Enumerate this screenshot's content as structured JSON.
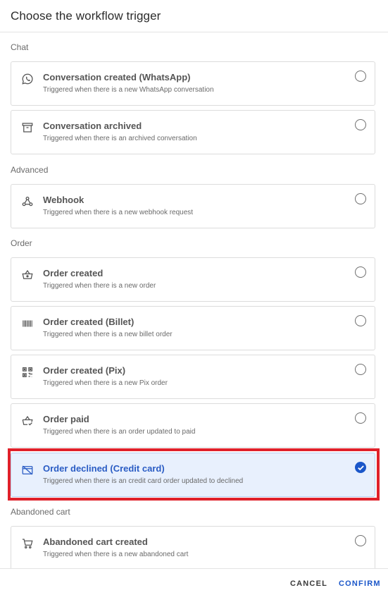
{
  "dialog": {
    "title": "Choose the workflow trigger"
  },
  "sections": {
    "chat": "Chat",
    "advanced": "Advanced",
    "order": "Order",
    "abandoned": "Abandoned cart"
  },
  "triggers": [
    {
      "icon": "whatsapp-icon",
      "label": "Conversation created (WhatsApp)",
      "desc": "Triggered when there is a new WhatsApp conversation",
      "selected": false
    },
    {
      "icon": "archive-icon",
      "label": "Conversation archived",
      "desc": "Triggered when there is an archived conversation",
      "selected": false
    },
    {
      "icon": "webhook-icon",
      "label": "Webhook",
      "desc": "Triggered when there is a new webhook request",
      "selected": false
    },
    {
      "icon": "basket-icon",
      "label": "Order created",
      "desc": "Triggered when there is a new order",
      "selected": false
    },
    {
      "icon": "barcode-icon",
      "label": "Order created (Billet)",
      "desc": "Triggered when there is a new billet order",
      "selected": false
    },
    {
      "icon": "qr-code-icon",
      "label": "Order created (Pix)",
      "desc": "Triggered when there is a new Pix order",
      "selected": false
    },
    {
      "icon": "basket-check-icon",
      "label": "Order paid",
      "desc": "Triggered when there is an order updated to paid",
      "selected": false
    },
    {
      "icon": "credit-card-off-icon",
      "label": "Order declined (Credit card)",
      "desc": "Triggered when there is an credit card order updated to declined",
      "selected": true
    },
    {
      "icon": "cart-icon",
      "label": "Abandoned cart created",
      "desc": "Triggered when there is a new abandoned cart",
      "selected": false
    }
  ],
  "footer": {
    "cancel": "CANCEL",
    "confirm": "CONFIRM"
  },
  "colors": {
    "accent": "#1a56c9",
    "selected_bg": "#e8f0fd",
    "highlight": "#e0202a"
  }
}
